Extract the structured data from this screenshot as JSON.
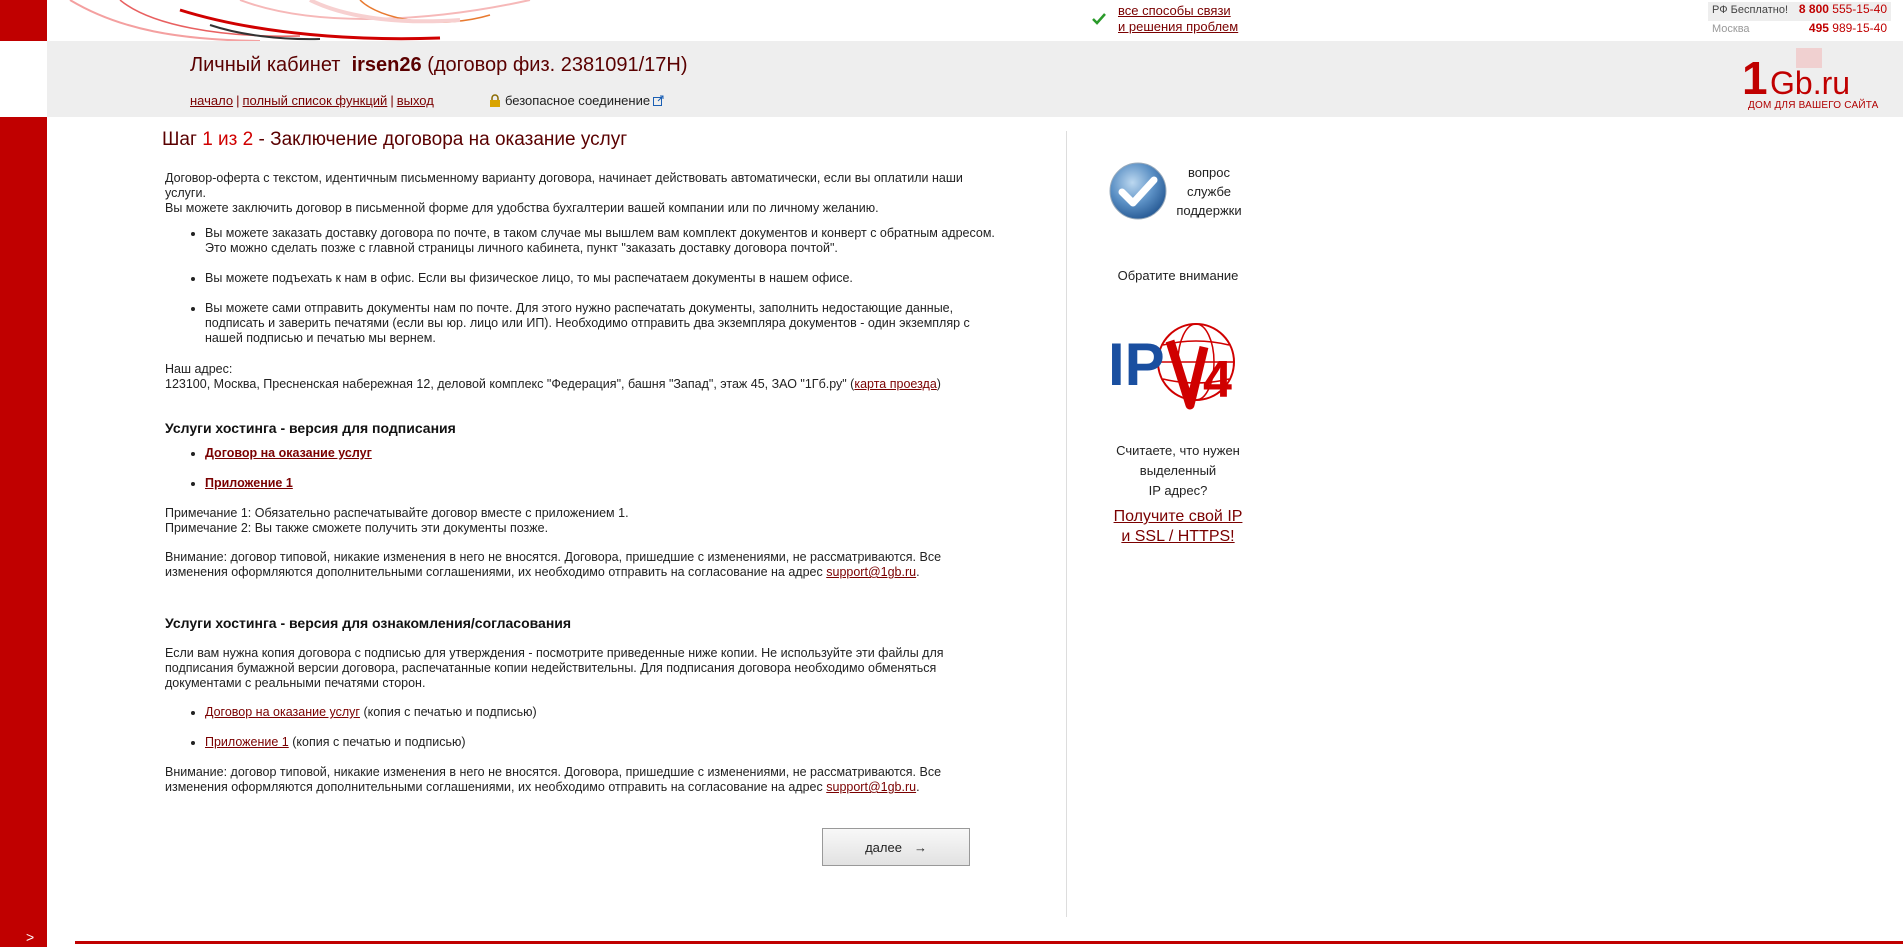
{
  "support": {
    "line1": "все способы связи",
    "line2": "и решения проблем"
  },
  "phones": {
    "free_label": "РФ Бесплатно!",
    "free_code": "8 800",
    "free_number": "555-15-40",
    "moscow_label": "Москва",
    "moscow_code": "495",
    "moscow_number": "989-15-40"
  },
  "header": {
    "title_prefix": "Личный кабинет",
    "username": "irsen26",
    "contract": "(договор физ. 2381091/17Н)",
    "nav": [
      {
        "label": "начало"
      },
      {
        "label": "полный список функций"
      },
      {
        "label": "выход"
      }
    ],
    "secure_label": "безопасное соединение"
  },
  "logo": {
    "text": "1Gb.ru",
    "tagline": "ДОМ ДЛЯ ВАШЕГО САЙТА"
  },
  "step": {
    "word": "Шаг",
    "num": "1 из 2",
    "title": "- Заключение договора на оказание услуг"
  },
  "intro": {
    "p1": "Договор-оферта с текстом, идентичным письменному варианту договора, начинает действовать автоматически, если вы оплатили наши услуги.",
    "p2": "Вы можете заключить договор в письменной форме для удобства бухгалтерии вашей компании или по личному желанию.",
    "bullets": [
      "Вы можете заказать доставку договора по почте, в таком случае мы вышлем вам комплект документов и конверт с обратным адресом. Это можно сделать позже с главной страницы личного кабинета, пункт \"заказать доставку договора почтой\".",
      "Вы можете подъехать к нам в офис. Если вы физическое лицо, то мы распечатаем документы в нашем офисе.",
      "Вы можете сами отправить документы нам по почте. Для этого нужно распечатать документы, заполнить недостающие данные, подписать и заверить печатями (если вы юр. лицо или ИП). Необходимо отправить два экземпляра документов - один экземпляр с нашей подписью и печатью мы вернем."
    ]
  },
  "address": {
    "label": "Наш адрес:",
    "text": "123100, Москва, Пресненская набережная 12, деловой комплекс \"Федерация\", башня \"Запад\", этаж 45, ЗАО \"1Гб.ру\" (",
    "map_link": "карта проезда",
    "close": ")"
  },
  "section_sign": {
    "title": "Услуги хостинга - версия для подписания",
    "links": [
      "Договор на оказание услуг",
      "Приложение 1"
    ],
    "note1": "Примечание 1: Обязательно распечатывайте договор вместе с приложением 1.",
    "note2": "Примечание 2: Вы также сможете получить эти документы позже.",
    "warning": "Внимание: договор типовой, никакие изменения в него не вносятся. Договора, пришедшие с изменениями, не рассматриваются. Все изменения оформляются дополнительными соглашениями, их необходимо отправить на согласование на адрес",
    "email": "support@1gb.ru",
    "dot": "."
  },
  "section_review": {
    "title": "Услуги хостинга - версия для ознакомления/согласования",
    "desc": "Если вам нужна копия договора с подписью для утверждения - посмотрите приведенные ниже копии. Не используйте эти файлы для подписания бумажной версии договора, распечатанные копии недействительны. Для подписания договора необходимо обменяться документами с реальными печатями сторон.",
    "links": [
      {
        "label": "Договор на оказание услуг",
        "suffix": " (копия с печатью и подписью)"
      },
      {
        "label": "Приложение 1",
        "suffix": " (копия с печатью и подписью)"
      }
    ],
    "warning": "Внимание: договор типовой, никакие изменения в него не вносятся. Договора, пришедшие с изменениями, не рассматриваются. Все изменения оформляются дополнительными соглашениями, их необходимо отправить на согласование на адрес",
    "email": "support@1gb.ru",
    "dot": "."
  },
  "next_button": {
    "label": "далее",
    "arrow": "→"
  },
  "sidebar": {
    "support_l1": "вопрос",
    "support_l2": "службе",
    "support_l3": "поддержки",
    "attention": "Обратите внимание",
    "ipv4_text": "IP",
    "ipv4_num": "4",
    "q1": "Считаете, что нужен",
    "q2": "выделенный",
    "q3": "IP адрес?",
    "link1": "Получите свой IP",
    "link2": "и SSL / HTTPS!"
  },
  "colors": {
    "brand_red": "#c00000",
    "dark_red": "#5a0000",
    "link": "#7a0000"
  }
}
